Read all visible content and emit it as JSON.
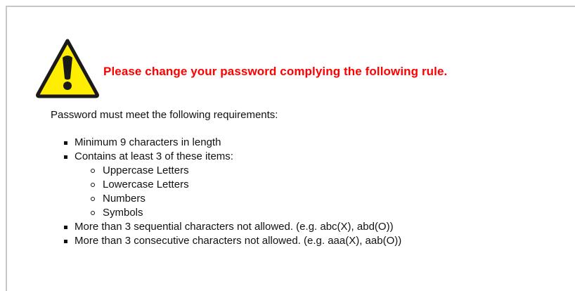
{
  "icons": {
    "warning": "warning-icon"
  },
  "colors": {
    "heading": "#ff0000",
    "icon_fill": "#ffee00",
    "frame_border": "#c8c8c8"
  },
  "notice": {
    "heading": "Please change your password complying the following rule.",
    "intro": "Password must meet the following requirements:",
    "rules": [
      "Minimum 9 characters in length",
      "Contains at least 3 of these items:",
      "More than 3 sequential characters not allowed. (e.g. abc(X), abd(O))",
      "More than 3 consecutive characters not allowed. (e.g. aaa(X), aab(O))"
    ],
    "items": [
      "Uppercase Letters",
      "Lowercase Letters",
      "Numbers",
      "Symbols"
    ]
  }
}
